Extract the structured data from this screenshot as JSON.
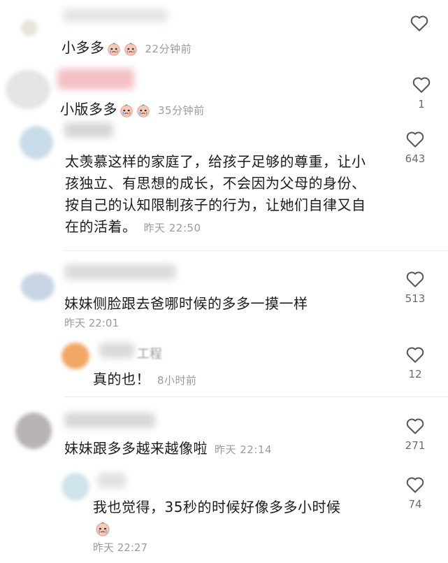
{
  "comments": [
    {
      "author": "小多多",
      "time": "22分钟前"
    },
    {
      "author": "小版多多",
      "time": "35分钟前",
      "likes": "1"
    },
    {
      "text": "太羡慕这样的家庭了，给孩子足够的尊重，让小孩独立、有思想的成长，不会因为父母的身份、按自己的认知限制孩子的行为，让她们自律又自在的活着。",
      "time": "昨天 22:50",
      "likes": "643"
    },
    {
      "text": "妹妹侧脸跟去爸哪时候的多多一摸一样",
      "time": "昨天 22:01",
      "likes": "513"
    },
    {
      "author_visible": "工程",
      "text": "真的也！",
      "time": "8小时前",
      "likes": "12"
    },
    {
      "text": "妹妹跟多多越来越像啦",
      "time": "昨天 22:14",
      "likes": "271"
    },
    {
      "text": "我也觉得，35秒的时候好像多多小时候",
      "time": "昨天 22:27",
      "likes": "74"
    }
  ],
  "icons": {
    "like": "heart-outline-icon",
    "emoji": "crying-face-emoji-icon"
  },
  "colors": {
    "meta": "#9b9b9b",
    "text": "#1b1b1b",
    "heart": "#555555"
  }
}
